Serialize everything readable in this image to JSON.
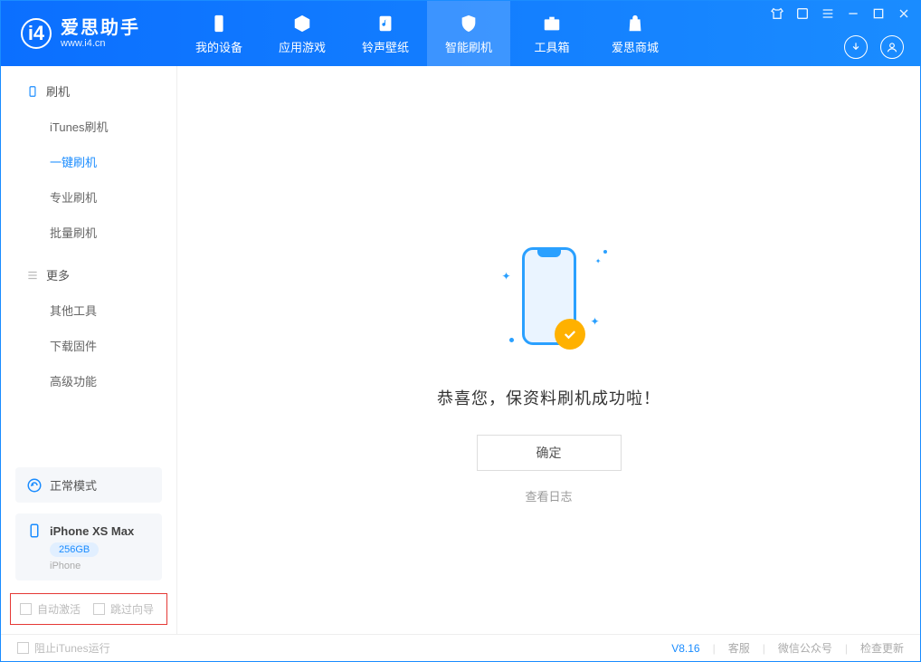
{
  "app": {
    "name_cn": "爱思助手",
    "name_en": "www.i4.cn"
  },
  "tabs": {
    "device": "我的设备",
    "apps": "应用游戏",
    "ringtones": "铃声壁纸",
    "flash": "智能刷机",
    "toolbox": "工具箱",
    "store": "爱思商城"
  },
  "sidebar": {
    "group_flash": "刷机",
    "items_flash": {
      "itunes": "iTunes刷机",
      "oneclick": "一键刷机",
      "pro": "专业刷机",
      "batch": "批量刷机"
    },
    "group_more": "更多",
    "items_more": {
      "other": "其他工具",
      "firmware": "下载固件",
      "advanced": "高级功能"
    }
  },
  "mode": {
    "label": "正常模式"
  },
  "device": {
    "name": "iPhone XS Max",
    "capacity": "256GB",
    "type": "iPhone"
  },
  "highlight": {
    "auto_activate": "自动激活",
    "skip_guide": "跳过向导"
  },
  "main": {
    "success": "恭喜您，保资料刷机成功啦！",
    "confirm": "确定",
    "view_log": "查看日志"
  },
  "footer": {
    "block_itunes": "阻止iTunes运行",
    "version": "V8.16",
    "support": "客服",
    "wechat": "微信公众号",
    "check_update": "检查更新"
  }
}
